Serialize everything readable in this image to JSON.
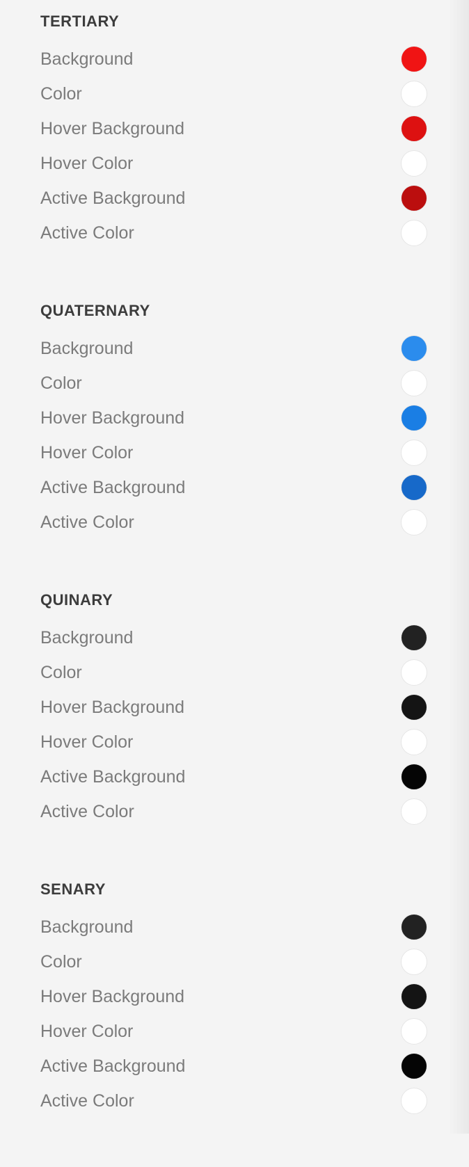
{
  "sections": [
    {
      "title": "TERTIARY",
      "items": [
        {
          "label": "Background",
          "color": "#f01414"
        },
        {
          "label": "Color",
          "color": "#ffffff"
        },
        {
          "label": "Hover Background",
          "color": "#dd1111"
        },
        {
          "label": "Hover Color",
          "color": "#ffffff"
        },
        {
          "label": "Active Background",
          "color": "#bb0e0e"
        },
        {
          "label": "Active Color",
          "color": "#ffffff"
        }
      ]
    },
    {
      "title": "QUATERNARY",
      "items": [
        {
          "label": "Background",
          "color": "#2b8ced"
        },
        {
          "label": "Color",
          "color": "#ffffff"
        },
        {
          "label": "Hover Background",
          "color": "#1a7ee4"
        },
        {
          "label": "Hover Color",
          "color": "#ffffff"
        },
        {
          "label": "Active Background",
          "color": "#1769c9"
        },
        {
          "label": "Active Color",
          "color": "#ffffff"
        }
      ]
    },
    {
      "title": "QUINARY",
      "items": [
        {
          "label": "Background",
          "color": "#222222"
        },
        {
          "label": "Color",
          "color": "#ffffff"
        },
        {
          "label": "Hover Background",
          "color": "#141414"
        },
        {
          "label": "Hover Color",
          "color": "#ffffff"
        },
        {
          "label": "Active Background",
          "color": "#050505"
        },
        {
          "label": "Active Color",
          "color": "#ffffff"
        }
      ]
    },
    {
      "title": "SENARY",
      "items": [
        {
          "label": "Background",
          "color": "#222222"
        },
        {
          "label": "Color",
          "color": "#ffffff"
        },
        {
          "label": "Hover Background",
          "color": "#141414"
        },
        {
          "label": "Hover Color",
          "color": "#ffffff"
        },
        {
          "label": "Active Background",
          "color": "#050505"
        },
        {
          "label": "Active Color",
          "color": "#ffffff"
        }
      ]
    }
  ]
}
